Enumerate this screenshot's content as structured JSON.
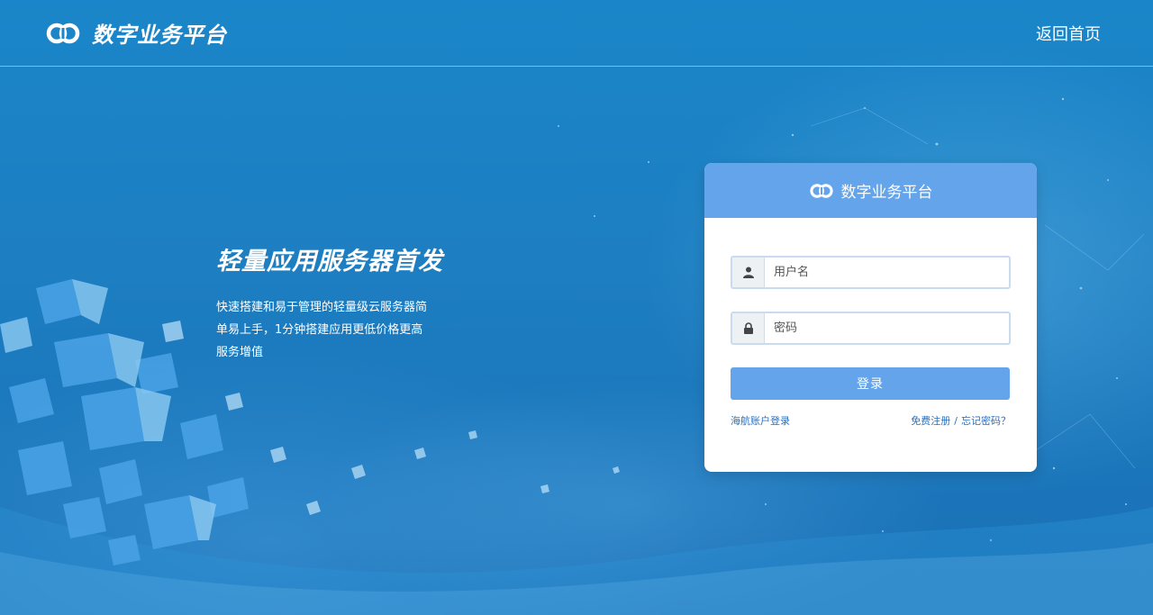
{
  "header": {
    "brand": "数字业务平台",
    "home_link": "返回首页"
  },
  "hero": {
    "title": "轻量应用服务器首发",
    "description": "快速搭建和易于管理的轻量级云服务器简单易上手，1分钟搭建应用更低价格更高服务增值"
  },
  "login": {
    "title": "数字业务平台",
    "username_placeholder": "用户名",
    "password_placeholder": "密码",
    "submit_label": "登录",
    "alt_login_link": "海航账户登录",
    "register_link": "免费注册",
    "separator": "/",
    "forgot_link": "忘记密码？"
  },
  "icons": {
    "brand_logo": "linked-rings-logo-icon",
    "username": "user-icon",
    "password": "lock-icon"
  },
  "colors": {
    "accent": "#63a4ea",
    "link": "#2a6fbe",
    "background": "#1a86c9"
  }
}
